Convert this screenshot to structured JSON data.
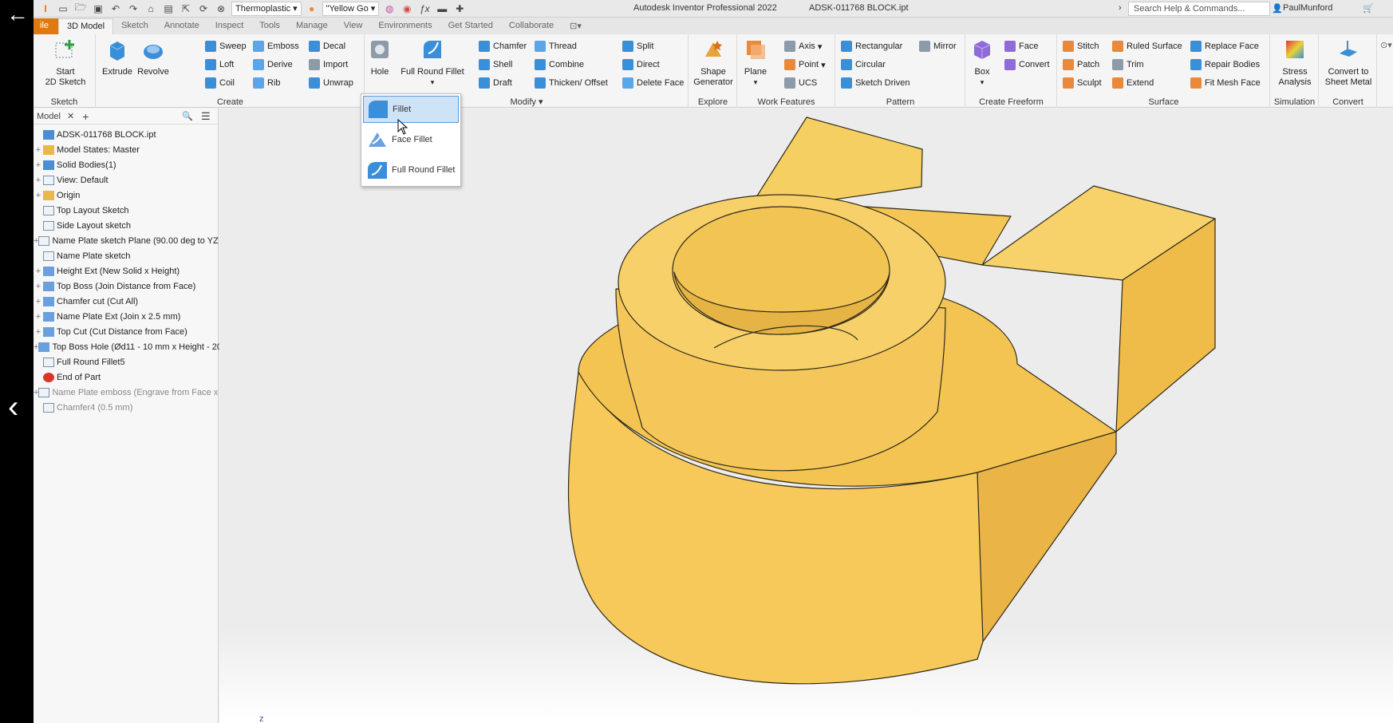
{
  "nav": {
    "back_glyph": "←",
    "prev_glyph": "‹"
  },
  "titlebar": {
    "app_title": "Autodesk Inventor Professional 2022",
    "doc_title": "ADSK-011768 BLOCK.ipt",
    "material": "Thermoplastic",
    "appearance": "\"Yellow Go",
    "search_placeholder": "Search Help & Commands...",
    "user": "PaulMunford"
  },
  "tabs": [
    "ile",
    "3D Model",
    "Sketch",
    "Annotate",
    "Inspect",
    "Tools",
    "Manage",
    "View",
    "Environments",
    "Get Started",
    "Collaborate"
  ],
  "ribbon": {
    "sketch": {
      "title": "Sketch",
      "start_line1": "Start",
      "start_line2": "2D Sketch"
    },
    "create": {
      "title": "Create",
      "extrude": "Extrude",
      "revolve": "Revolve",
      "sweep": "Sweep",
      "loft": "Loft",
      "coil": "Coil",
      "emboss": "Emboss",
      "derive": "Derive",
      "rib": "Rib",
      "decal": "Decal",
      "import": "Import",
      "unwrap": "Unwrap"
    },
    "modify": {
      "title": "Modify",
      "hole": "Hole",
      "full_round_fillet": "Full Round Fillet",
      "chamfer": "Chamfer",
      "shell": "Shell",
      "draft": "Draft",
      "thread": "Thread",
      "combine": "Combine",
      "thicken": "Thicken/ Offset",
      "split": "Split",
      "direct": "Direct",
      "delete_face": "Delete Face"
    },
    "explore": {
      "title": "Explore",
      "shape_line1": "Shape",
      "shape_line2": "Generator"
    },
    "work": {
      "title": "Work Features",
      "plane": "Plane",
      "axis": "Axis",
      "point": "Point",
      "ucs": "UCS"
    },
    "pattern": {
      "title": "Pattern",
      "rectangular": "Rectangular",
      "circular": "Circular",
      "sketch_driven": "Sketch Driven",
      "mirror": "Mirror"
    },
    "freeform": {
      "title": "Create Freeform",
      "box": "Box",
      "face": "Face",
      "convert": "Convert"
    },
    "surface": {
      "title": "Surface",
      "stitch": "Stitch",
      "patch": "Patch",
      "sculpt": "Sculpt",
      "ruled": "Ruled Surface",
      "trim": "Trim",
      "extend": "Extend",
      "replace": "Replace Face",
      "repair": "Repair Bodies",
      "fitmesh": "Fit Mesh Face"
    },
    "simulation": {
      "title": "Simulation",
      "line1": "Stress",
      "line2": "Analysis"
    },
    "convert": {
      "title": "Convert",
      "line1": "Convert to",
      "line2": "Sheet Metal"
    }
  },
  "dropdown": {
    "items": [
      "Fillet",
      "Face Fillet",
      "Full Round Fillet"
    ]
  },
  "browser": {
    "tab_label": "Model",
    "items": [
      {
        "label": "ADSK-011768 BLOCK.ipt",
        "expand": ""
      },
      {
        "label": "Model States: Master",
        "expand": "+"
      },
      {
        "label": "Solid Bodies(1)",
        "expand": "+"
      },
      {
        "label": "View: Default",
        "expand": "+"
      },
      {
        "label": "Origin",
        "expand": "+"
      },
      {
        "label": "Top Layout Sketch",
        "expand": ""
      },
      {
        "label": "Side Layout sketch",
        "expand": ""
      },
      {
        "label": "Name Plate sketch Plane (90.00 deg to YZ I",
        "expand": "+"
      },
      {
        "label": "Name Plate sketch",
        "expand": ""
      },
      {
        "label": "Height Ext (New Solid x Height)",
        "expand": "+"
      },
      {
        "label": "Top Boss (Join Distance from Face)",
        "expand": "+"
      },
      {
        "label": "Chamfer cut (Cut All)",
        "expand": "+"
      },
      {
        "label": "Name Plate Ext (Join x 2.5 mm)",
        "expand": "+"
      },
      {
        "label": "Top Cut (Cut Distance from Face)",
        "expand": "+"
      },
      {
        "label": "Top Boss Hole (Ød11 - 10 mm x Height - 20",
        "expand": "+"
      },
      {
        "label": "Full Round Fillet5",
        "expand": ""
      },
      {
        "label": "End of Part",
        "expand": ""
      },
      {
        "label": "Name Plate emboss (Engrave from Face x (",
        "expand": "+"
      },
      {
        "label": "Chamfer4 (0.5 mm)",
        "expand": ""
      }
    ]
  },
  "viewport": {
    "axis_label": "z",
    "part_color": "#f6c95a"
  },
  "colors": {
    "file_tab": "#e07a10",
    "accent": "#3b8fd8"
  }
}
